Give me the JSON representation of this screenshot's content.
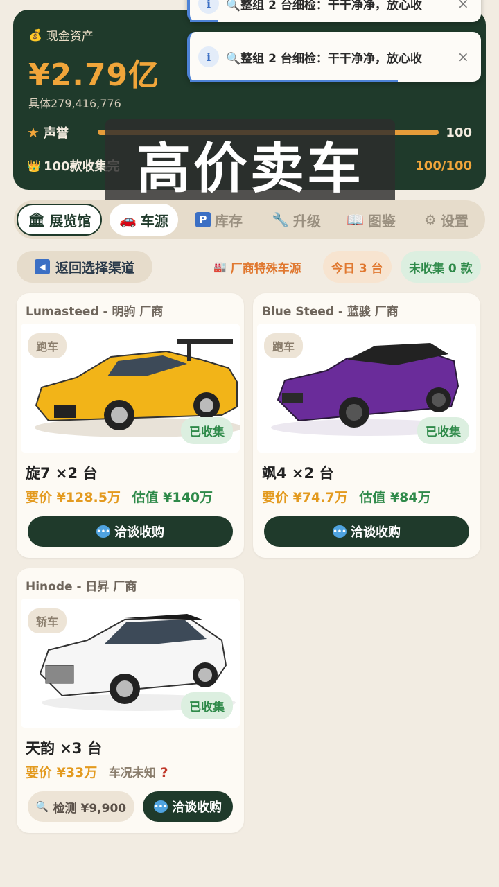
{
  "header": {
    "cash_label": "现金资产",
    "cash_amount": "¥2.79亿",
    "cash_exact": "具体279,416,776",
    "reputation_label": "声誉",
    "reputation_value": "100",
    "reputation_fraction": 1.0,
    "collection_label": "100款收集完",
    "collection_value": "100/100",
    "collection_fraction": 1.0
  },
  "toasts": [
    {
      "text": "🔍整组 2 台细检：干干净净，放心收"
    },
    {
      "text": "🔍整组 2 台细检：干干净净，放心收"
    }
  ],
  "overlay_title": "高价卖车",
  "tabs": [
    {
      "label": "展览馆",
      "icon": "🏛"
    },
    {
      "label": "车源",
      "icon": "🚗"
    },
    {
      "label": "库存",
      "icon": "P"
    },
    {
      "label": "升级",
      "icon": "🔧"
    },
    {
      "label": "图鉴",
      "icon": "📖"
    },
    {
      "label": "设置",
      "icon": "⚙"
    }
  ],
  "toolbar": {
    "back_label": "返回选择渠道",
    "channel_label": "厂商特殊车源",
    "today_label": "今日 3 台",
    "uncollected_label": "未收集 0 款"
  },
  "cars": [
    {
      "brand": "Lumasteed - 明驹 厂商",
      "type": "跑车",
      "status": "已收集",
      "name": "旋7 ×2 台",
      "ask": "要价 ¥128.5万",
      "estimate": "估值 ¥140万",
      "action": "洽谈收购",
      "color": "#f2b418"
    },
    {
      "brand": "Blue Steed - 蓝骏 厂商",
      "type": "跑车",
      "status": "已收集",
      "name": "飒4 ×2 台",
      "ask": "要价 ¥74.7万",
      "estimate": "估值 ¥84万",
      "action": "洽谈收购",
      "color": "#6a2c9a"
    },
    {
      "brand": "Hinode - 日昇 厂商",
      "type": "轿车",
      "status": "已收集",
      "name": "天韵 ×3 台",
      "ask": "要价 ¥33万",
      "condition": "车况未知",
      "condition_mark": "?",
      "inspect": "检测 ¥9,900",
      "action": "洽谈收购",
      "color": "#f6f6f6"
    }
  ]
}
